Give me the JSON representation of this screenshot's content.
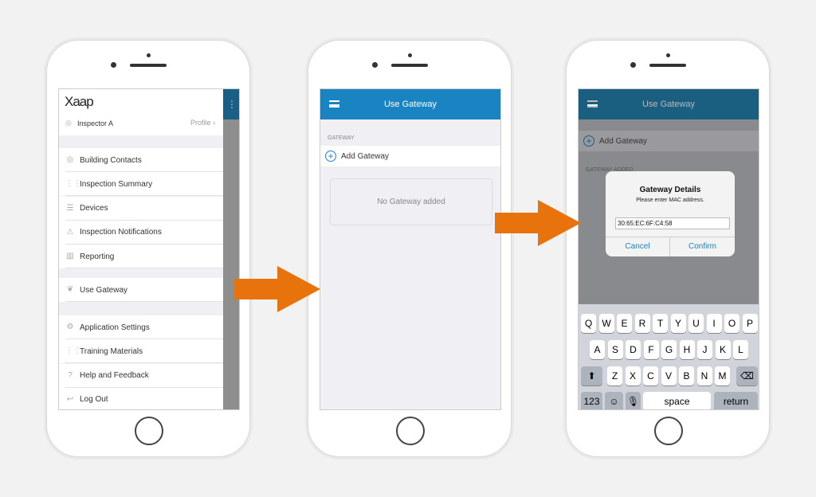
{
  "colors": {
    "accent": "#1a84c2",
    "arrow": "#e8720c",
    "background": "#f2f2f2"
  },
  "screen1": {
    "logo": "Xaap",
    "user": "Inspector A",
    "profile_link": "Profile",
    "menu": [
      {
        "label": "Building Contacts",
        "icon": "contacts-icon"
      },
      {
        "label": "Inspection Summary",
        "icon": "sliders-icon"
      },
      {
        "label": "Devices",
        "icon": "checklist-icon"
      },
      {
        "label": "Inspection Notifications",
        "icon": "warning-icon"
      },
      {
        "label": "Reporting",
        "icon": "chart-icon"
      }
    ],
    "menu2": [
      {
        "label": "Use Gateway",
        "icon": "leaf-icon"
      }
    ],
    "menu3": [
      {
        "label": "Application Settings",
        "icon": "gear-icon"
      },
      {
        "label": "Training Materials",
        "icon": "sliders-icon"
      },
      {
        "label": "Help and Feedback",
        "icon": "help-icon"
      },
      {
        "label": "Log Out",
        "icon": "logout-icon"
      }
    ]
  },
  "screen2": {
    "title": "Use Gateway",
    "section": "GATEWAY",
    "add_label": "Add Gateway",
    "empty": "No Gateway added"
  },
  "screen3": {
    "title": "Use Gateway",
    "add_label": "Add Gateway",
    "section": "GATEWAY ADDED",
    "dialog": {
      "title": "Gateway Details",
      "message": "Please enter MAC address.",
      "value": "30:65:EC:6F:C4:58",
      "cancel": "Cancel",
      "confirm": "Confirm"
    },
    "keyboard": {
      "row1": [
        "Q",
        "W",
        "E",
        "R",
        "T",
        "Y",
        "U",
        "I",
        "O",
        "P"
      ],
      "row2": [
        "A",
        "S",
        "D",
        "F",
        "G",
        "H",
        "J",
        "K",
        "L"
      ],
      "row3": [
        "Z",
        "X",
        "C",
        "V",
        "B",
        "N",
        "M"
      ],
      "numbers": "123",
      "space": "space",
      "return": "return"
    }
  }
}
